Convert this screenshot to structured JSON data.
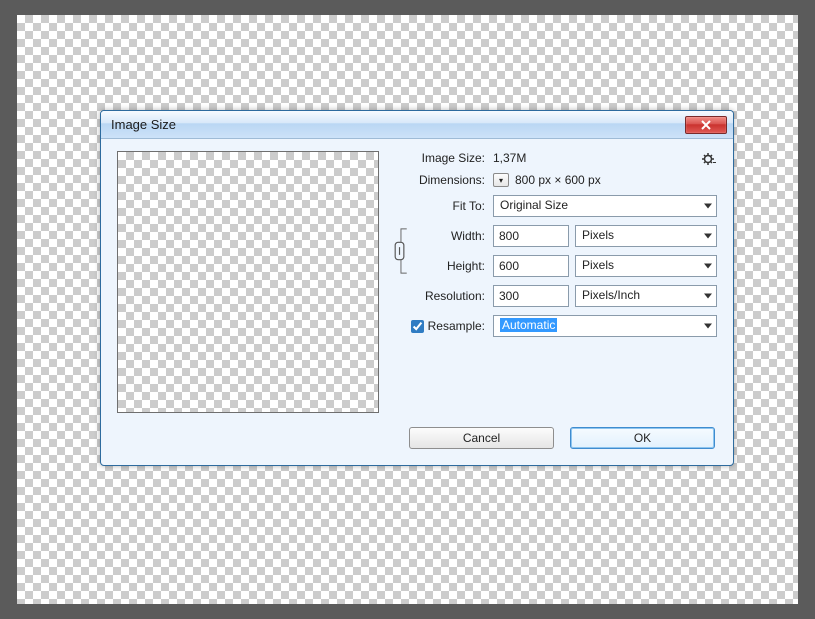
{
  "dialog": {
    "title": "Image Size",
    "imageSizeLabel": "Image Size:",
    "imageSizeValue": "1,37M",
    "dimensionsLabel": "Dimensions:",
    "dimensionsValue": "800 px  ×  600 px",
    "fitToLabel": "Fit To:",
    "fitToValue": "Original Size",
    "widthLabel": "Width:",
    "widthValue": "800",
    "widthUnit": "Pixels",
    "heightLabel": "Height:",
    "heightValue": "600",
    "heightUnit": "Pixels",
    "resolutionLabel": "Resolution:",
    "resolutionValue": "300",
    "resolutionUnit": "Pixels/Inch",
    "resampleLabel": "Resample:",
    "resampleChecked": true,
    "resampleValue": "Automatic",
    "cancelLabel": "Cancel",
    "okLabel": "OK"
  }
}
